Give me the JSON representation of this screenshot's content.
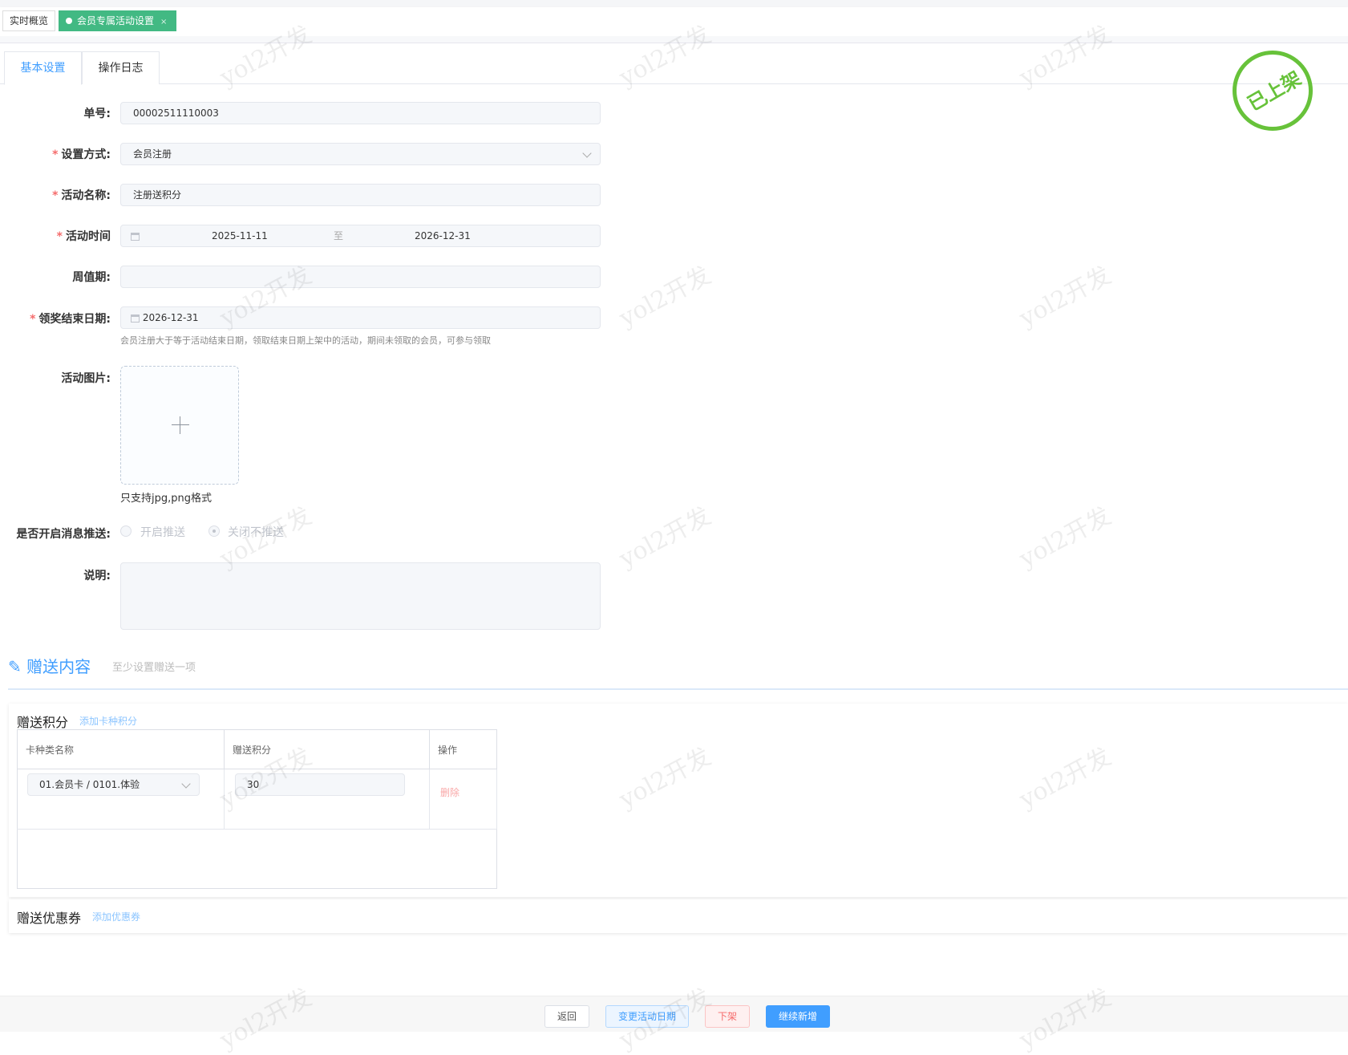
{
  "page_tabs": [
    {
      "label": "实时概览"
    },
    {
      "label": "会员专属活动设置",
      "close": "×"
    }
  ],
  "form_tabs": [
    {
      "label": "基本设置"
    },
    {
      "label": "操作日志"
    }
  ],
  "stamp": "已上架",
  "form": {
    "order_no": {
      "label": "单号:",
      "value": "00002511110003"
    },
    "mode": {
      "label": "设置方式:",
      "value": "会员注册"
    },
    "name": {
      "label": "活动名称:",
      "value": "注册送积分"
    },
    "time": {
      "label": "活动时间",
      "start": "2025-11-11",
      "sep": "至",
      "end": "2026-12-31"
    },
    "period": {
      "label": "周值期:",
      "value": ""
    },
    "claim_end": {
      "label": "领奖结束日期:",
      "value": "2026-12-31",
      "hint": "会员注册大于等于活动结束日期，领取结束日期上架中的活动，期间未领取的会员，可参与领取"
    },
    "image": {
      "label": "活动图片:",
      "hint": "只支持jpg,png格式"
    },
    "push": {
      "label": "是否开启消息推送:",
      "options": [
        "开启推送",
        "关闭不推送"
      ],
      "selected": "关闭不推送"
    },
    "desc": {
      "label": "说明:",
      "value": ""
    }
  },
  "gift": {
    "title": "赠送内容",
    "subtitle": "至少设置赠送一项"
  },
  "points": {
    "title": "赠送积分",
    "add": "添加卡种积分",
    "columns": [
      "卡种类名称",
      "赠送积分",
      "操作"
    ],
    "rows": [
      {
        "card": "01.会员卡 / 0101.体验",
        "points": "30",
        "action": "删除"
      }
    ]
  },
  "coupons": {
    "title": "赠送优惠券",
    "add": "添加优惠券"
  },
  "footer": {
    "back": "返回",
    "change_date": "变更活动日期",
    "offline": "下架",
    "continue": "继续新增"
  },
  "watermark": "yol2开发"
}
